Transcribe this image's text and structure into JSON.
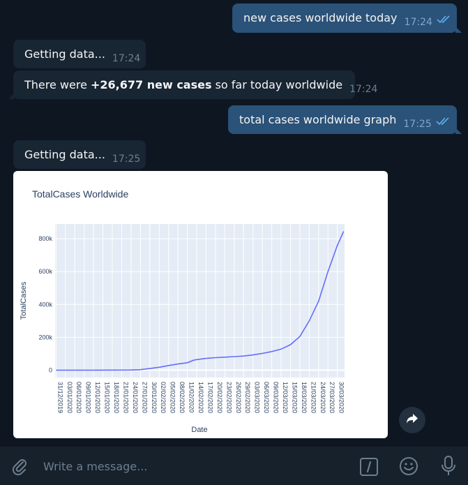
{
  "messages": [
    {
      "text": "new cases worldwide today",
      "time": "17:24"
    },
    {
      "text": "Getting data...",
      "time": "17:24"
    },
    {
      "prefix": "There were ",
      "bold": "+26,677 new cases",
      "suffix": " so far today worldwide",
      "time": "17:24"
    },
    {
      "text": "total cases worldwide graph",
      "time": "17:25"
    },
    {
      "text": "Getting data...",
      "time": "17:25"
    }
  ],
  "composer": {
    "placeholder": "Write a message..."
  },
  "icons": {
    "attach": "paperclip-icon",
    "commands": "slash-command-icon",
    "emoji": "smiley-icon",
    "mic": "microphone-icon",
    "share": "forward-arrow-icon",
    "read": "double-check-icon"
  },
  "colors": {
    "background": "#0e1621",
    "outgoing_bubble": "#2b5278",
    "incoming_bubble": "#182533",
    "composer": "#17212b",
    "chart_line": "#636efa",
    "chart_plot_bg": "#e5ecf6"
  },
  "chart_data": {
    "type": "line",
    "title": "TotalCases Worldwide",
    "xlabel": "Date",
    "ylabel": "TotalCases",
    "x_ticks": [
      "31/12/2019",
      "03/01/2020",
      "06/01/2020",
      "09/01/2020",
      "12/01/2020",
      "15/01/2020",
      "18/01/2020",
      "21/01/2020",
      "24/01/2020",
      "27/01/2020",
      "30/01/2020",
      "02/02/2020",
      "05/02/2020",
      "08/02/2020",
      "11/02/2020",
      "14/02/2020",
      "17/02/2020",
      "20/02/2020",
      "23/02/2020",
      "26/02/2020",
      "29/02/2020",
      "03/03/2020",
      "06/03/2020",
      "09/03/2020",
      "12/03/2020",
      "15/03/2020",
      "18/03/2020",
      "21/03/2020",
      "24/03/2020",
      "27/03/2020",
      "30/03/2020"
    ],
    "y_ticks": [
      "0",
      "200k",
      "400k",
      "600k",
      "800k"
    ],
    "y_tick_values": [
      0,
      200000,
      400000,
      600000,
      800000
    ],
    "ylim": [
      -45000,
      890000
    ],
    "grid": true,
    "series": [
      {
        "x": [
          "31/12/2019",
          "06/01/2020",
          "12/01/2020",
          "18/01/2020",
          "24/01/2020",
          "27/01/2020",
          "30/01/2020",
          "02/02/2020",
          "05/02/2020",
          "08/02/2020",
          "11/02/2020",
          "13/02/2020",
          "14/02/2020",
          "17/02/2020",
          "20/02/2020",
          "23/02/2020",
          "26/02/2020",
          "29/02/2020",
          "03/03/2020",
          "06/03/2020",
          "09/03/2020",
          "12/03/2020",
          "15/03/2020",
          "18/03/2020",
          "21/03/2020",
          "24/03/2020",
          "27/03/2020",
          "30/03/2020",
          "01/04/2020"
        ],
        "y": [
          30,
          60,
          90,
          300,
          900,
          3000,
          9800,
          17400,
          28200,
          37600,
          45200,
          60300,
          64400,
          71400,
          76100,
          78900,
          82300,
          86000,
          92800,
          102000,
          113000,
          128000,
          155000,
          205000,
          300000,
          420000,
          600000,
          760000,
          845000
        ]
      }
    ]
  }
}
